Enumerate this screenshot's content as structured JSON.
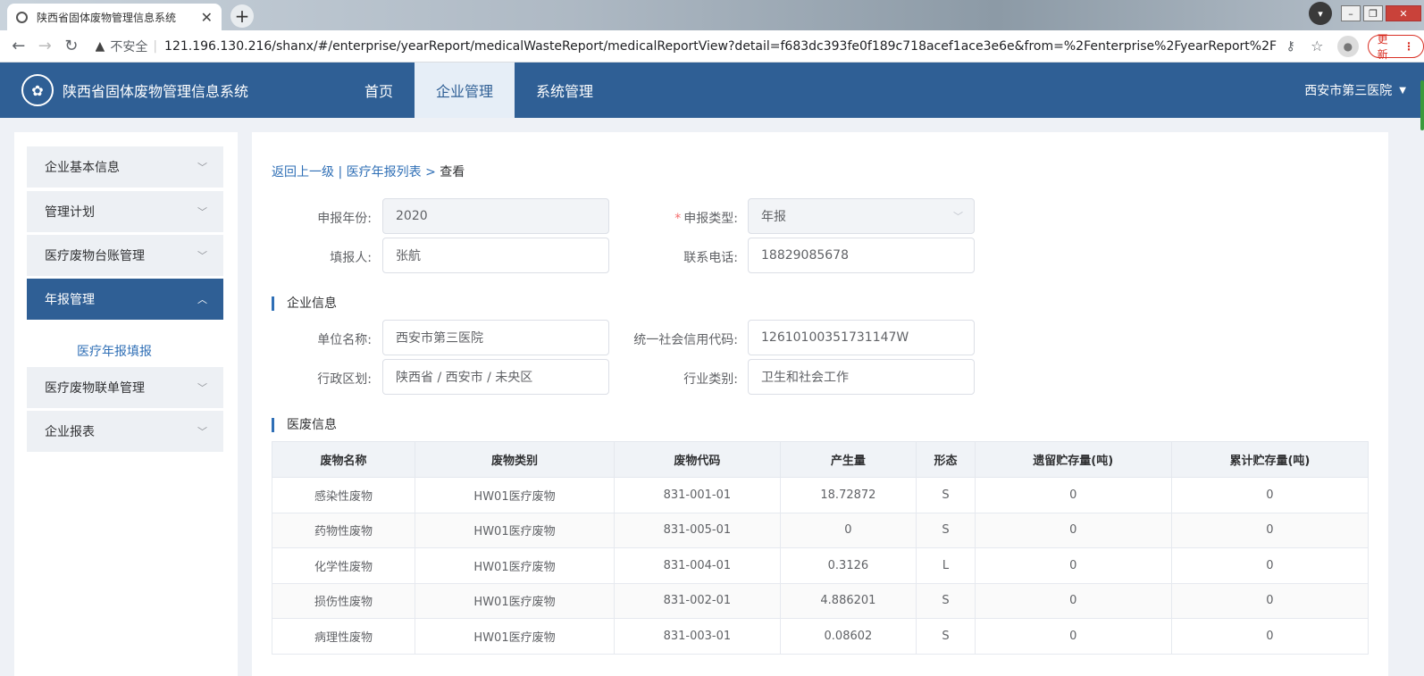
{
  "browser": {
    "tab_title": "陕西省固体废物管理信息系统",
    "tab_close": "✕",
    "new_tab": "+",
    "security_label": "不安全",
    "url": "121.196.130.216/shanx/#/enterprise/yearReport/medicalWasteReport/medicalReportView?detail=f683dc393fe0f189c718acef1ace3e6e&from=%2Fenterprise%2FyearReport%2Fm...",
    "update_label": "更新"
  },
  "header": {
    "system_name": "陕西省固体废物管理信息系统",
    "nav": [
      {
        "label": "首页"
      },
      {
        "label": "企业管理"
      },
      {
        "label": "系统管理"
      }
    ],
    "user": "西安市第三医院"
  },
  "sidebar": {
    "items": [
      {
        "label": "企业基本信息"
      },
      {
        "label": "管理计划"
      },
      {
        "label": "医疗废物台账管理"
      },
      {
        "label": "年报管理"
      },
      {
        "label": "医疗废物联单管理"
      },
      {
        "label": "企业报表"
      }
    ],
    "sub_item": "医疗年报填报"
  },
  "breadcrumb": {
    "back": "返回上一级",
    "sep": " | ",
    "list": "医疗年报列表",
    "arrow": " > ",
    "current": "查看"
  },
  "form": {
    "year_label": "申报年份:",
    "year_value": "2020",
    "type_label": "申报类型:",
    "type_value": "年报",
    "filler_label": "填报人:",
    "filler_value": "张航",
    "phone_label": "联系电话:",
    "phone_value": "18829085678"
  },
  "enterprise": {
    "section_title": "企业信息",
    "name_label": "单位名称:",
    "name_value": "西安市第三医院",
    "credit_label": "统一社会信用代码:",
    "credit_value": "12610100351731147W",
    "region_label": "行政区划:",
    "region_value": "陕西省 / 西安市 / 未央区",
    "industry_label": "行业类别:",
    "industry_value": "卫生和社会工作"
  },
  "waste": {
    "section_title": "医废信息",
    "columns": [
      "废物名称",
      "废物类别",
      "废物代码",
      "产生量",
      "形态",
      "遗留贮存量(吨)",
      "累计贮存量(吨)"
    ],
    "rows": [
      [
        "感染性废物",
        "HW01医疗废物",
        "831-001-01",
        "18.72872",
        "S",
        "0",
        "0"
      ],
      [
        "药物性废物",
        "HW01医疗废物",
        "831-005-01",
        "0",
        "S",
        "0",
        "0"
      ],
      [
        "化学性废物",
        "HW01医疗废物",
        "831-004-01",
        "0.3126",
        "L",
        "0",
        "0"
      ],
      [
        "损伤性废物",
        "HW01医疗废物",
        "831-002-01",
        "4.886201",
        "S",
        "0",
        "0"
      ],
      [
        "病理性废物",
        "HW01医疗废物",
        "831-003-01",
        "0.08602",
        "S",
        "0",
        "0"
      ]
    ]
  }
}
